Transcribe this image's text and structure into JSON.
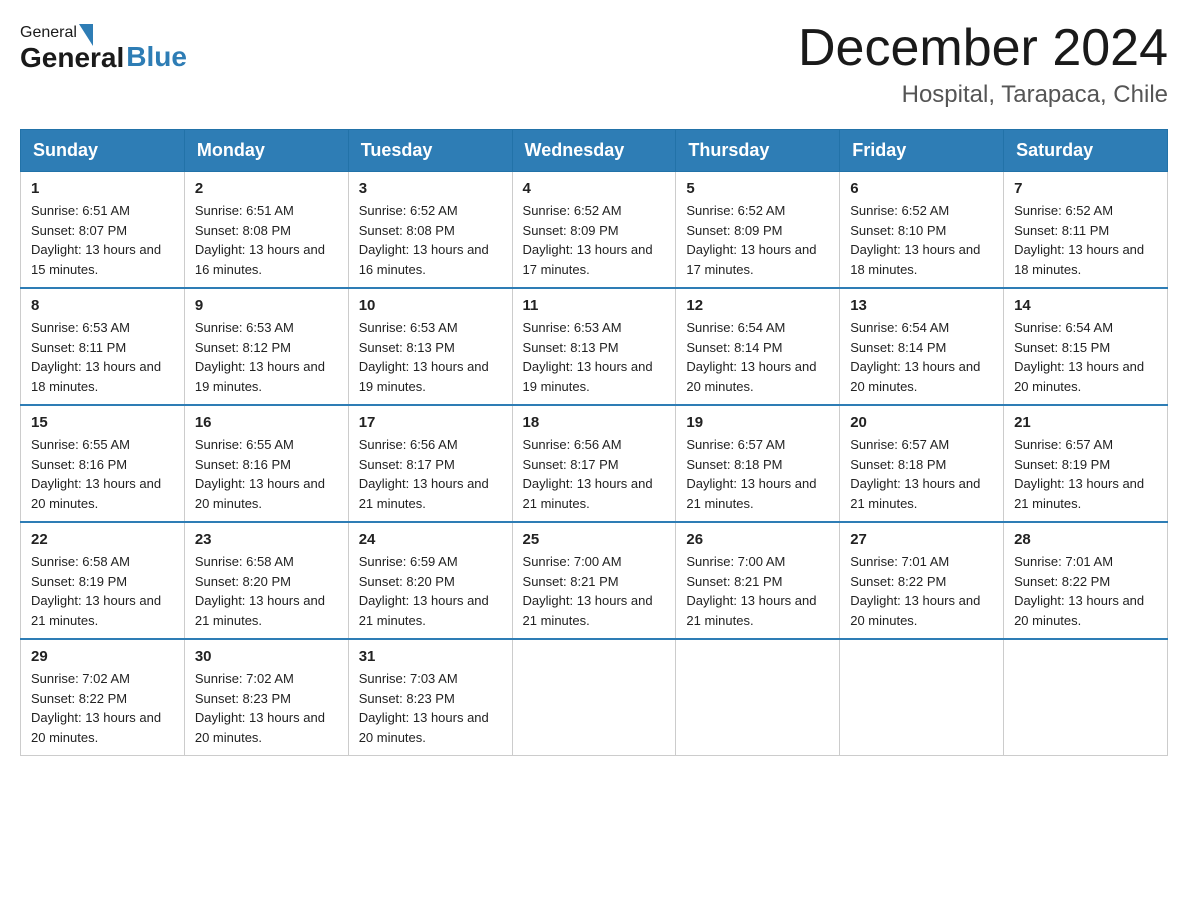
{
  "header": {
    "logo_general": "General",
    "logo_blue": "Blue",
    "month_title": "December 2024",
    "location": "Hospital, Tarapaca, Chile"
  },
  "calendar": {
    "days_of_week": [
      "Sunday",
      "Monday",
      "Tuesday",
      "Wednesday",
      "Thursday",
      "Friday",
      "Saturday"
    ],
    "weeks": [
      [
        {
          "day": "1",
          "sunrise": "6:51 AM",
          "sunset": "8:07 PM",
          "daylight": "13 hours and 15 minutes."
        },
        {
          "day": "2",
          "sunrise": "6:51 AM",
          "sunset": "8:08 PM",
          "daylight": "13 hours and 16 minutes."
        },
        {
          "day": "3",
          "sunrise": "6:52 AM",
          "sunset": "8:08 PM",
          "daylight": "13 hours and 16 minutes."
        },
        {
          "day": "4",
          "sunrise": "6:52 AM",
          "sunset": "8:09 PM",
          "daylight": "13 hours and 17 minutes."
        },
        {
          "day": "5",
          "sunrise": "6:52 AM",
          "sunset": "8:09 PM",
          "daylight": "13 hours and 17 minutes."
        },
        {
          "day": "6",
          "sunrise": "6:52 AM",
          "sunset": "8:10 PM",
          "daylight": "13 hours and 18 minutes."
        },
        {
          "day": "7",
          "sunrise": "6:52 AM",
          "sunset": "8:11 PM",
          "daylight": "13 hours and 18 minutes."
        }
      ],
      [
        {
          "day": "8",
          "sunrise": "6:53 AM",
          "sunset": "8:11 PM",
          "daylight": "13 hours and 18 minutes."
        },
        {
          "day": "9",
          "sunrise": "6:53 AM",
          "sunset": "8:12 PM",
          "daylight": "13 hours and 19 minutes."
        },
        {
          "day": "10",
          "sunrise": "6:53 AM",
          "sunset": "8:13 PM",
          "daylight": "13 hours and 19 minutes."
        },
        {
          "day": "11",
          "sunrise": "6:53 AM",
          "sunset": "8:13 PM",
          "daylight": "13 hours and 19 minutes."
        },
        {
          "day": "12",
          "sunrise": "6:54 AM",
          "sunset": "8:14 PM",
          "daylight": "13 hours and 20 minutes."
        },
        {
          "day": "13",
          "sunrise": "6:54 AM",
          "sunset": "8:14 PM",
          "daylight": "13 hours and 20 minutes."
        },
        {
          "day": "14",
          "sunrise": "6:54 AM",
          "sunset": "8:15 PM",
          "daylight": "13 hours and 20 minutes."
        }
      ],
      [
        {
          "day": "15",
          "sunrise": "6:55 AM",
          "sunset": "8:16 PM",
          "daylight": "13 hours and 20 minutes."
        },
        {
          "day": "16",
          "sunrise": "6:55 AM",
          "sunset": "8:16 PM",
          "daylight": "13 hours and 20 minutes."
        },
        {
          "day": "17",
          "sunrise": "6:56 AM",
          "sunset": "8:17 PM",
          "daylight": "13 hours and 21 minutes."
        },
        {
          "day": "18",
          "sunrise": "6:56 AM",
          "sunset": "8:17 PM",
          "daylight": "13 hours and 21 minutes."
        },
        {
          "day": "19",
          "sunrise": "6:57 AM",
          "sunset": "8:18 PM",
          "daylight": "13 hours and 21 minutes."
        },
        {
          "day": "20",
          "sunrise": "6:57 AM",
          "sunset": "8:18 PM",
          "daylight": "13 hours and 21 minutes."
        },
        {
          "day": "21",
          "sunrise": "6:57 AM",
          "sunset": "8:19 PM",
          "daylight": "13 hours and 21 minutes."
        }
      ],
      [
        {
          "day": "22",
          "sunrise": "6:58 AM",
          "sunset": "8:19 PM",
          "daylight": "13 hours and 21 minutes."
        },
        {
          "day": "23",
          "sunrise": "6:58 AM",
          "sunset": "8:20 PM",
          "daylight": "13 hours and 21 minutes."
        },
        {
          "day": "24",
          "sunrise": "6:59 AM",
          "sunset": "8:20 PM",
          "daylight": "13 hours and 21 minutes."
        },
        {
          "day": "25",
          "sunrise": "7:00 AM",
          "sunset": "8:21 PM",
          "daylight": "13 hours and 21 minutes."
        },
        {
          "day": "26",
          "sunrise": "7:00 AM",
          "sunset": "8:21 PM",
          "daylight": "13 hours and 21 minutes."
        },
        {
          "day": "27",
          "sunrise": "7:01 AM",
          "sunset": "8:22 PM",
          "daylight": "13 hours and 20 minutes."
        },
        {
          "day": "28",
          "sunrise": "7:01 AM",
          "sunset": "8:22 PM",
          "daylight": "13 hours and 20 minutes."
        }
      ],
      [
        {
          "day": "29",
          "sunrise": "7:02 AM",
          "sunset": "8:22 PM",
          "daylight": "13 hours and 20 minutes."
        },
        {
          "day": "30",
          "sunrise": "7:02 AM",
          "sunset": "8:23 PM",
          "daylight": "13 hours and 20 minutes."
        },
        {
          "day": "31",
          "sunrise": "7:03 AM",
          "sunset": "8:23 PM",
          "daylight": "13 hours and 20 minutes."
        },
        null,
        null,
        null,
        null
      ]
    ]
  }
}
